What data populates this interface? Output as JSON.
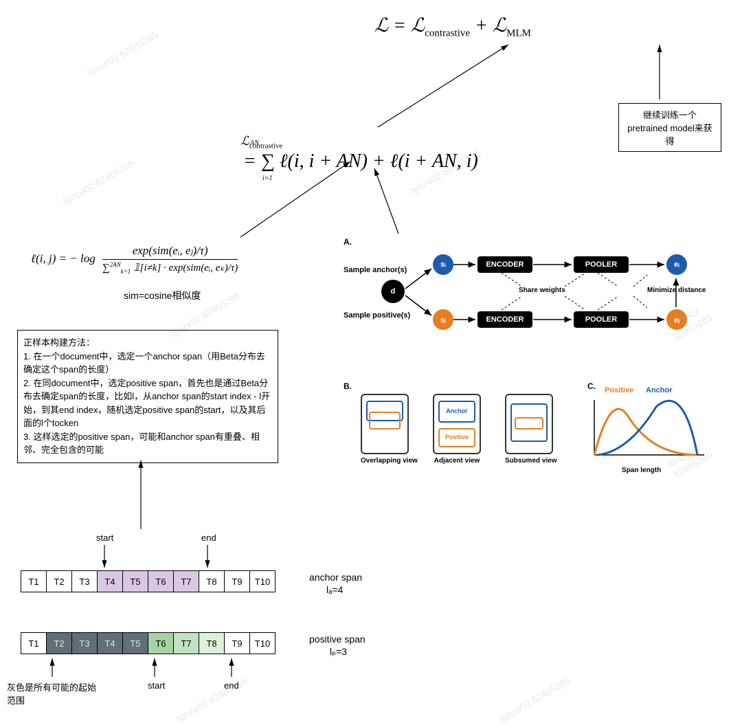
{
  "watermark": "lijinze02\n62465265",
  "equations": {
    "main_left": "ℒ = ℒ",
    "main_sub1": "contrastive",
    "main_plus": " + ℒ",
    "main_sub2": "MLM",
    "contrastive_lhs": "ℒ",
    "contrastive_sub": "contrastive",
    "contrastive_rhs_top": "AN",
    "contrastive_rhs_body": " = ∑ ℓ(i, i + AN) + ℓ(i + AN, i)",
    "contrastive_rhs_bot": "i=1",
    "loss_lhs": "ℓ(i, j) = − log",
    "loss_num": "exp(sim(eᵢ, eⱼ)/τ)",
    "loss_den_pre": "∑",
    "loss_den_sup": "2AN",
    "loss_den_sub": "k=1",
    "loss_den_body": " 𝟙[i≠k] · exp(sim(eᵢ, eₖ)/τ)",
    "sim_note": "sim=cosine相似度"
  },
  "mlm_box": "继续训练一个pretrained model来获得",
  "positive_box_title": "正样本构建方法：",
  "positive_box_items": [
    "1. 在一个document中，选定一个anchor span（用Beta分布去确定这个span的长度）",
    "2. 在同document中，选定positive span，首先也是通过Beta分布去确定span的长度，比如l，从anchor span的start index - l开始，到其end index，随机选定positive span的start，以及其后面的l个tocken",
    "3. 这样选定的positive span，可能和anchor span有重叠、相邻、完全包含的可能"
  ],
  "tokens_row1": [
    "T1",
    "T2",
    "T3",
    "T4",
    "T5",
    "T6",
    "T7",
    "T8",
    "T9",
    "T10"
  ],
  "tokens_row2": [
    "T1",
    "T2",
    "T3",
    "T4",
    "T5",
    "T6",
    "T7",
    "T8",
    "T9",
    "T10"
  ],
  "labels": {
    "start": "start",
    "end": "end",
    "anchor_span": "anchor span",
    "anchor_la": "lₐ=4",
    "positive_span": "positive span",
    "positive_lp": "lₚ=3",
    "grey_note": "灰色是所有可能的起始范围"
  },
  "diagram_a": {
    "title": "A.",
    "sample_anchor": "Sample anchor(s)",
    "sample_positive": "Sample positive(s)",
    "d": "d",
    "si": "sᵢ",
    "sj": "sⱼ",
    "ei": "eᵢ",
    "ej": "eⱼ",
    "encoder": "ENCODER",
    "pooler": "POOLER",
    "share": "Share weights",
    "minimize": "Minimize distance"
  },
  "diagram_b": {
    "title": "B.",
    "overlapping": "Overlapping view",
    "adjacent": "Adjacent view",
    "subsumed": "Subsumed view",
    "anchor": "Anchor",
    "positive": "Positive"
  },
  "diagram_c": {
    "title": "C.",
    "span_length": "Span length",
    "positive_label": "Positive",
    "anchor_label": "Anchor"
  }
}
